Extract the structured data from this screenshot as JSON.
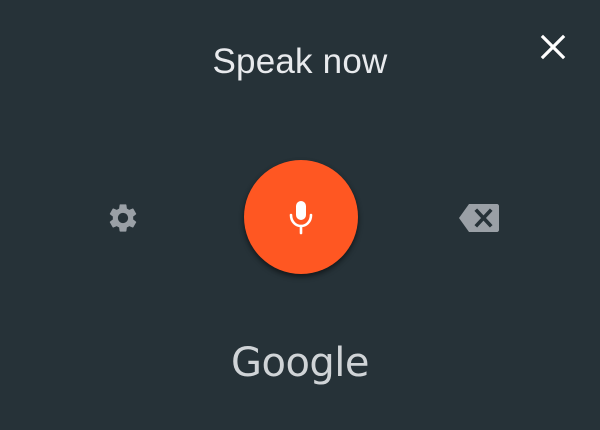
{
  "dialog": {
    "prompt": "Speak now",
    "brand": "Google"
  },
  "icons": {
    "close": "close-icon",
    "settings": "gear-icon",
    "mic": "microphone-icon",
    "backspace": "backspace-icon"
  },
  "colors": {
    "background": "#263238",
    "mic_button": "#ff5722",
    "icon": "#9aa0a6",
    "close_icon": "#ffffff",
    "prompt_text": "#e8eaed",
    "brand_text": "#d0d4d7"
  }
}
